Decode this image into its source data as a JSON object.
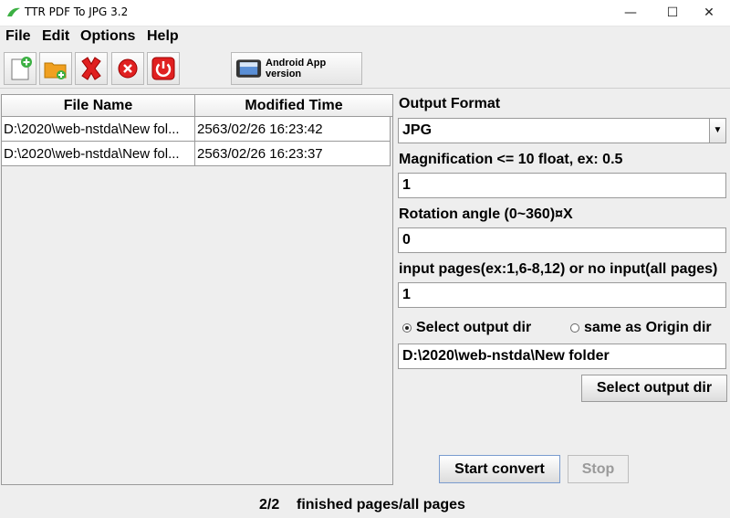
{
  "window": {
    "title": "TTR PDF To JPG 3.2",
    "minimize_glyph": "—",
    "maximize_glyph": "☐",
    "close_glyph": "✕"
  },
  "menu": {
    "items": [
      "File",
      "Edit",
      "Options",
      "Help"
    ]
  },
  "toolbar": {
    "buttons": [
      {
        "icon": "add-file-icon"
      },
      {
        "icon": "add-folder-icon"
      },
      {
        "icon": "remove-icon"
      },
      {
        "icon": "cancel-icon"
      },
      {
        "icon": "power-icon"
      }
    ],
    "android_label": "Android App version"
  },
  "file_table": {
    "headers": [
      "File Name",
      "Modified Time"
    ],
    "rows": [
      {
        "file_name": "D:\\2020\\web-nstda\\New fol...",
        "modified": "2563/02/26 16:23:42"
      },
      {
        "file_name": "D:\\2020\\web-nstda\\New fol...",
        "modified": "2563/02/26 16:23:37"
      }
    ]
  },
  "settings": {
    "output_format_label": "Output Format",
    "output_format_value": "JPG",
    "magnification_label": "Magnification <= 10 float, ex: 0.5",
    "magnification_value": "1",
    "rotation_label": "Rotation angle (0~360)¤X",
    "rotation_value": "0",
    "pages_label": "input pages(ex:1,6-8,12) or no input(all pages)",
    "pages_value": "1",
    "radio_select_output": "Select output dir",
    "radio_same_origin": "same as Origin dir",
    "output_dir_value": "D:\\2020\\web-nstda\\New folder",
    "select_output_button": "Select output dir"
  },
  "actions": {
    "start_label": "Start convert",
    "stop_label": "Stop"
  },
  "status": {
    "progress": "2/2",
    "text": "finished pages/all pages"
  },
  "colors": {
    "window_bg": "#eeeeee",
    "red": "#e02020",
    "orange": "#f0a020",
    "green": "#3cb043"
  }
}
